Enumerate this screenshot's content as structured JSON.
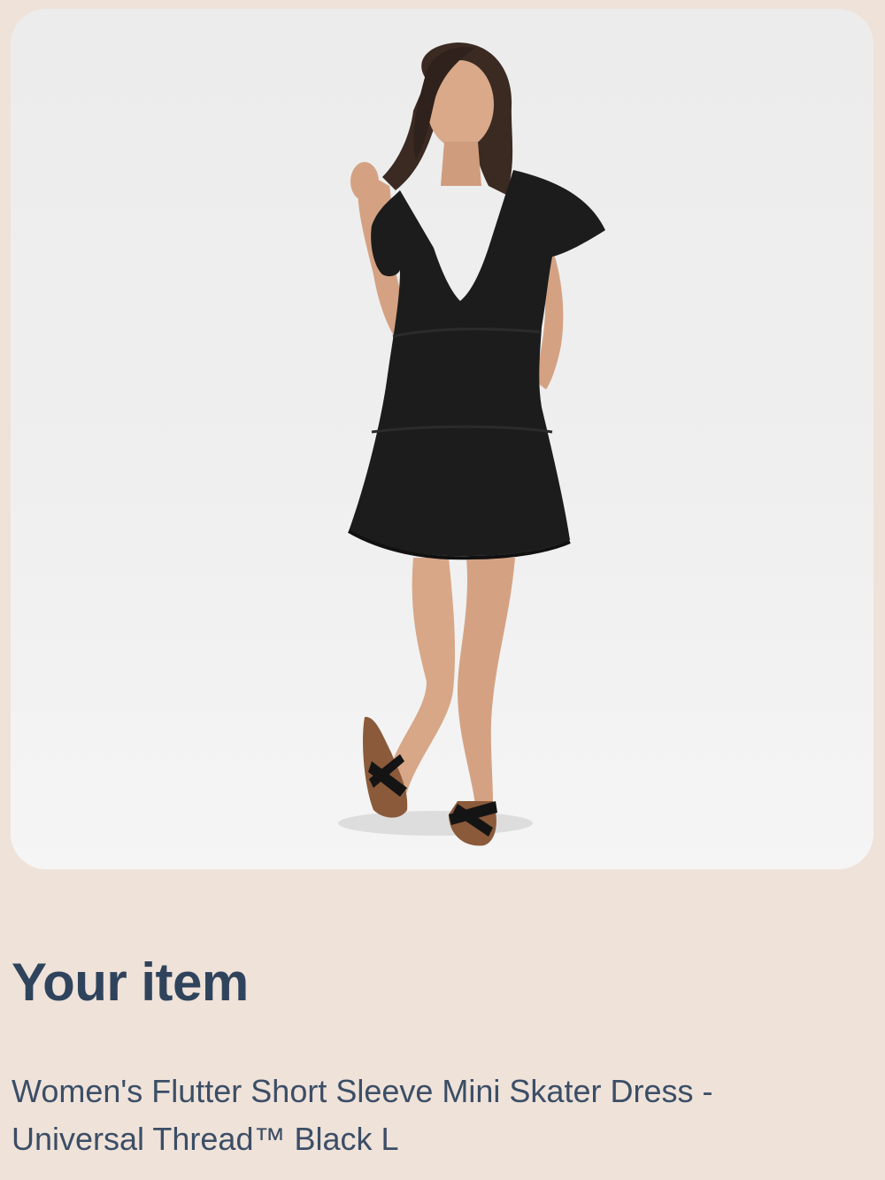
{
  "section": {
    "title": "Your item"
  },
  "item": {
    "name_line1": "Women's Flutter Short Sleeve Mini Skater Dress -",
    "name_line2": "Universal Thread™ Black L",
    "image_subject": "product-photo"
  },
  "colors": {
    "page_background": "#efe2d9",
    "title_text": "#2f445c",
    "body_text": "#3b4e66",
    "dress": "#1c1c1c"
  }
}
